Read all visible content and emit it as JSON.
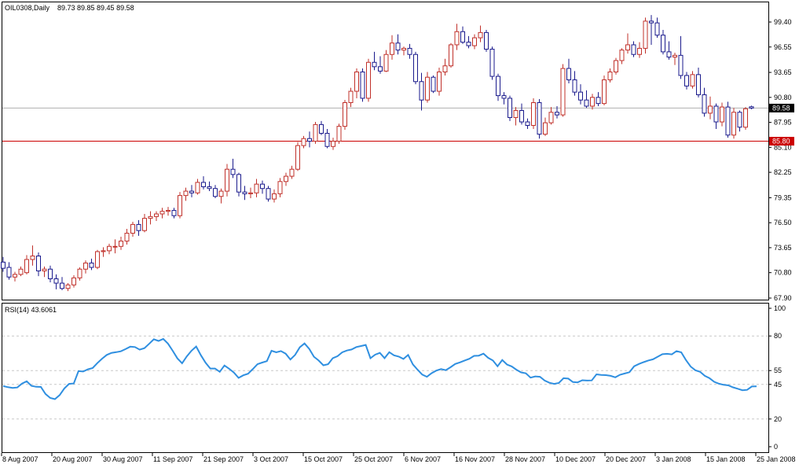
{
  "header": {
    "symbol_label": "OIL0308,Daily",
    "ohlc_label": "89.73 89.85 89.45 89.58",
    "rsi_label": "RSI(14) 43.6061"
  },
  "colors": {
    "up_candle": "#c0302a",
    "down_candle": "#1a1a8c",
    "rsi_line": "#2f8fe0",
    "level_line": "#cc0000",
    "current_price_line": "#b0b0b0",
    "current_price_badge": "#000000",
    "level_badge": "#cc0000"
  },
  "chart_data": [
    {
      "type": "candlestick",
      "title": "OIL0308,Daily",
      "ylim": [
        67.9,
        100.9
      ],
      "y_ticks": [
        "99.40",
        "96.55",
        "93.65",
        "90.80",
        "87.95",
        "85.10",
        "82.25",
        "79.35",
        "76.50",
        "73.65",
        "70.80",
        "67.90"
      ],
      "x_ticks": [
        "8 Aug 2007",
        "20 Aug 2007",
        "30 Aug 2007",
        "11 Sep 2007",
        "21 Sep 2007",
        "3 Oct 2007",
        "15 Oct 2007",
        "25 Oct 2007",
        "6 Nov 2007",
        "16 Nov 2007",
        "28 Nov 2007",
        "10 Dec 2007",
        "20 Dec 2007",
        "3 Jan 2008",
        "15 Jan 2008",
        "25 Jan 2008"
      ],
      "current_price": 89.58,
      "current_price_label": "89.58",
      "horizontal_level": 85.8,
      "horizontal_level_label": "85.80",
      "candles": [
        [
          72.0,
          72.6,
          70.9,
          71.3
        ],
        [
          71.4,
          72.0,
          70.0,
          70.3
        ],
        [
          70.3,
          70.9,
          69.8,
          70.6
        ],
        [
          70.6,
          71.5,
          70.4,
          71.2
        ],
        [
          70.8,
          72.8,
          70.6,
          72.3
        ],
        [
          72.3,
          73.9,
          71.6,
          72.7
        ],
        [
          72.7,
          73.1,
          70.4,
          71.0
        ],
        [
          71.0,
          71.5,
          70.3,
          71.2
        ],
        [
          71.2,
          71.6,
          69.7,
          70.1
        ],
        [
          70.1,
          70.6,
          68.9,
          69.6
        ],
        [
          69.6,
          70.3,
          68.8,
          69.0
        ],
        [
          69.0,
          69.6,
          68.7,
          69.4
        ],
        [
          69.4,
          70.5,
          69.1,
          70.2
        ],
        [
          70.2,
          71.4,
          69.9,
          71.2
        ],
        [
          71.2,
          72.2,
          70.7,
          71.9
        ],
        [
          71.9,
          72.4,
          71.1,
          71.4
        ],
        [
          71.4,
          73.4,
          71.2,
          73.2
        ],
        [
          73.2,
          73.7,
          72.6,
          73.3
        ],
        [
          73.3,
          74.1,
          72.9,
          73.8
        ],
        [
          73.8,
          74.6,
          73.0,
          73.8
        ],
        [
          73.8,
          74.9,
          73.4,
          74.4
        ],
        [
          74.4,
          75.8,
          74.0,
          75.3
        ],
        [
          75.3,
          76.6,
          74.9,
          76.3
        ],
        [
          76.3,
          76.8,
          75.0,
          75.6
        ],
        [
          75.6,
          77.5,
          75.4,
          77.0
        ],
        [
          77.0,
          77.8,
          76.3,
          77.2
        ],
        [
          77.2,
          77.8,
          76.7,
          77.5
        ],
        [
          77.5,
          78.2,
          77.0,
          77.8
        ],
        [
          77.8,
          78.3,
          77.3,
          77.9
        ],
        [
          77.9,
          78.2,
          77.0,
          77.3
        ],
        [
          77.3,
          80.0,
          77.0,
          79.6
        ],
        [
          79.6,
          80.5,
          79.0,
          80.1
        ],
        [
          80.1,
          80.8,
          79.4,
          79.9
        ],
        [
          79.9,
          81.5,
          79.7,
          81.1
        ],
        [
          81.1,
          81.8,
          80.3,
          80.6
        ],
        [
          80.6,
          81.2,
          80.1,
          80.4
        ],
        [
          80.4,
          80.8,
          79.3,
          79.5
        ],
        [
          79.5,
          80.4,
          78.7,
          80.1
        ],
        [
          80.1,
          83.2,
          79.5,
          82.6
        ],
        [
          82.6,
          83.8,
          81.6,
          82.0
        ],
        [
          82.0,
          82.2,
          79.5,
          80.0
        ],
        [
          80.0,
          80.7,
          79.1,
          79.8
        ],
        [
          79.8,
          80.5,
          79.3,
          79.9
        ],
        [
          79.9,
          81.5,
          79.4,
          80.9
        ],
        [
          80.9,
          81.3,
          79.8,
          80.4
        ],
        [
          80.4,
          80.7,
          78.9,
          79.2
        ],
        [
          79.2,
          80.3,
          78.8,
          79.8
        ],
        [
          79.8,
          81.6,
          79.4,
          81.2
        ],
        [
          81.2,
          82.2,
          80.7,
          81.8
        ],
        [
          81.8,
          83.0,
          81.5,
          82.6
        ],
        [
          82.6,
          85.7,
          82.4,
          85.3
        ],
        [
          85.3,
          86.4,
          85.0,
          86.1
        ],
        [
          86.1,
          86.9,
          85.1,
          85.8
        ],
        [
          85.8,
          88.0,
          85.5,
          87.7
        ],
        [
          87.7,
          88.1,
          86.5,
          86.7
        ],
        [
          86.7,
          87.2,
          85.0,
          85.2
        ],
        [
          85.2,
          86.2,
          84.8,
          85.8
        ],
        [
          85.8,
          87.8,
          85.5,
          87.5
        ],
        [
          87.5,
          90.5,
          87.1,
          90.2
        ],
        [
          90.2,
          91.9,
          89.7,
          91.5
        ],
        [
          91.5,
          94.1,
          90.7,
          93.7
        ],
        [
          93.7,
          94.1,
          90.3,
          90.7
        ],
        [
          90.7,
          95.2,
          90.3,
          94.8
        ],
        [
          94.8,
          96.0,
          93.9,
          94.3
        ],
        [
          94.3,
          95.5,
          93.5,
          93.8
        ],
        [
          93.8,
          96.2,
          93.7,
          95.7
        ],
        [
          95.7,
          97.9,
          95.1,
          97.0
        ],
        [
          97.0,
          98.0,
          95.7,
          96.2
        ],
        [
          96.2,
          96.6,
          95.6,
          96.4
        ],
        [
          96.4,
          96.9,
          95.2,
          95.7
        ],
        [
          95.7,
          96.0,
          92.3,
          92.6
        ],
        [
          92.6,
          93.6,
          89.3,
          90.5
        ],
        [
          90.5,
          93.7,
          90.2,
          93.1
        ],
        [
          93.1,
          93.3,
          91.3,
          91.5
        ],
        [
          91.5,
          94.2,
          91.0,
          93.7
        ],
        [
          93.7,
          95.2,
          93.3,
          94.4
        ],
        [
          94.4,
          97.0,
          94.2,
          96.8
        ],
        [
          96.8,
          99.2,
          96.2,
          98.3
        ],
        [
          98.3,
          98.9,
          96.9,
          97.1
        ],
        [
          97.1,
          97.8,
          96.4,
          96.7
        ],
        [
          96.7,
          98.0,
          96.3,
          97.6
        ],
        [
          97.6,
          99.0,
          97.1,
          98.2
        ],
        [
          98.2,
          98.5,
          96.0,
          96.3
        ],
        [
          96.3,
          96.6,
          92.8,
          93.2
        ],
        [
          93.2,
          93.5,
          90.4,
          91.0
        ],
        [
          91.0,
          91.4,
          90.0,
          90.7
        ],
        [
          90.7,
          91.0,
          88.1,
          88.5
        ],
        [
          88.5,
          89.7,
          87.6,
          89.3
        ],
        [
          89.3,
          90.1,
          87.7,
          88.0
        ],
        [
          88.0,
          88.4,
          87.2,
          87.6
        ],
        [
          87.6,
          90.7,
          87.2,
          90.2
        ],
        [
          90.2,
          90.6,
          86.1,
          86.6
        ],
        [
          86.6,
          88.5,
          86.4,
          87.9
        ],
        [
          87.9,
          89.7,
          87.7,
          89.1
        ],
        [
          89.1,
          89.8,
          88.4,
          88.8
        ],
        [
          88.8,
          94.6,
          88.6,
          94.1
        ],
        [
          94.1,
          95.2,
          92.4,
          92.8
        ],
        [
          92.8,
          93.8,
          91.0,
          91.4
        ],
        [
          91.4,
          92.3,
          90.0,
          90.5
        ],
        [
          90.5,
          91.6,
          89.6,
          89.8
        ],
        [
          89.8,
          91.2,
          89.4,
          90.8
        ],
        [
          90.8,
          91.4,
          89.8,
          90.1
        ],
        [
          90.1,
          93.3,
          89.9,
          92.8
        ],
        [
          92.8,
          94.1,
          92.5,
          93.7
        ],
        [
          93.7,
          95.3,
          93.4,
          95.0
        ],
        [
          95.0,
          96.4,
          94.6,
          96.2
        ],
        [
          96.2,
          98.1,
          95.8,
          96.8
        ],
        [
          96.8,
          97.2,
          95.4,
          95.7
        ],
        [
          95.7,
          97.1,
          95.3,
          96.4
        ],
        [
          96.4,
          99.9,
          95.8,
          99.5
        ],
        [
          99.5,
          100.2,
          96.8,
          99.3
        ],
        [
          99.3,
          99.9,
          97.6,
          97.9
        ],
        [
          97.9,
          98.5,
          95.7,
          96.0
        ],
        [
          96.0,
          97.2,
          95.1,
          95.4
        ],
        [
          95.4,
          95.9,
          94.5,
          95.6
        ],
        [
          95.6,
          97.8,
          92.9,
          93.3
        ],
        [
          93.3,
          93.7,
          91.7,
          92.1
        ],
        [
          92.1,
          93.8,
          91.8,
          93.4
        ],
        [
          93.4,
          94.2,
          90.8,
          91.1
        ],
        [
          91.1,
          91.9,
          88.6,
          89.0
        ],
        [
          89.0,
          90.9,
          88.3,
          89.8
        ],
        [
          89.8,
          90.1,
          87.2,
          88.0
        ],
        [
          88.0,
          90.2,
          87.5,
          89.7
        ],
        [
          89.7,
          90.3,
          86.2,
          86.5
        ],
        [
          86.5,
          89.6,
          86.1,
          89.1
        ],
        [
          89.1,
          89.3,
          86.9,
          87.4
        ],
        [
          87.4,
          89.7,
          87.1,
          89.5
        ],
        [
          89.73,
          89.85,
          89.45,
          89.58
        ]
      ]
    },
    {
      "type": "line",
      "title": "RSI(14) 43.6061",
      "ylim": [
        0,
        100
      ],
      "y_ticks": [
        "100",
        "80",
        "55",
        "45",
        "20",
        "0"
      ],
      "levels": [
        80,
        55,
        45,
        20
      ],
      "series": [
        {
          "values": [
            43.8,
            43.0,
            42.5,
            42.8,
            45.6,
            47.3,
            44.0,
            43.3,
            43.2,
            38.1,
            35.2,
            34.4,
            37.3,
            42.1,
            45.4,
            45.7,
            54.6,
            54.3,
            55.9,
            56.8,
            60.4,
            63.6,
            66.3,
            67.8,
            68.3,
            68.9,
            70.5,
            72.3,
            72.0,
            70.1,
            71.2,
            74.3,
            77.6,
            76.4,
            77.9,
            74.5,
            69.3,
            63.8,
            60.3,
            65.3,
            69.4,
            72.4,
            66.1,
            60.6,
            56.5,
            56.5,
            54.1,
            58.7,
            56.3,
            53.6,
            49.7,
            51.6,
            52.7,
            56.0,
            59.6,
            60.8,
            61.8,
            69.3,
            68.2,
            69.1,
            67.2,
            63.0,
            66.3,
            71.8,
            74.6,
            70.7,
            65.0,
            62.3,
            58.8,
            59.6,
            64.0,
            65.4,
            68.2,
            69.5,
            70.2,
            72.0,
            72.7,
            73.5,
            63.9,
            66.5,
            67.8,
            64.0,
            68.3,
            66.0,
            65.1,
            63.4,
            66.3,
            59.5,
            55.6,
            52.1,
            50.5,
            53.1,
            55.0,
            56.1,
            55.3,
            57.4,
            59.8,
            60.9,
            62.3,
            63.5,
            65.6,
            65.8,
            67.2,
            64.2,
            62.3,
            58.1,
            62.6,
            59.4,
            58.0,
            55.6,
            53.7,
            53.0,
            49.9,
            50.8,
            50.5,
            47.8,
            46.2,
            45.4,
            46.0,
            49.5,
            49.2,
            46.7,
            46.5,
            48.0,
            47.8,
            47.9,
            52.3,
            51.9,
            51.7,
            51.2,
            50.1,
            52.0,
            52.9,
            53.8,
            58.1,
            59.8,
            61.1,
            62.3,
            63.1,
            65.0,
            66.8,
            67.1,
            66.7,
            69.1,
            68.2,
            62.6,
            57.9,
            55.2,
            54.1,
            51.2,
            49.5,
            46.9,
            45.5,
            44.7,
            44.3,
            42.9,
            41.9,
            40.8,
            41.1,
            43.5,
            43.6
          ]
        }
      ]
    }
  ]
}
